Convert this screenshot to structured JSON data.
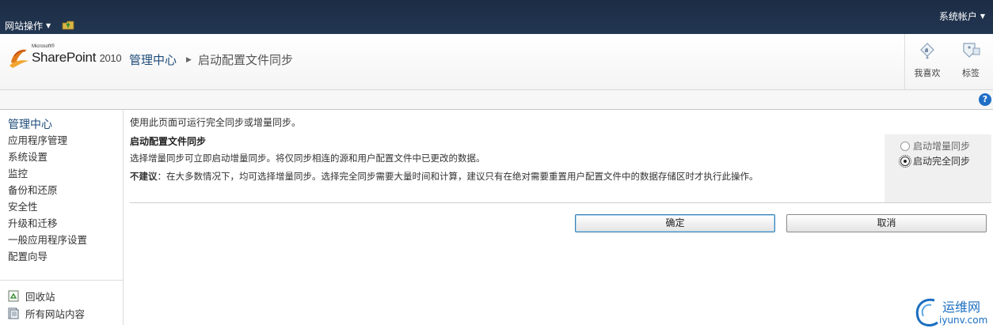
{
  "topbar": {
    "site_actions": "网站操作",
    "account": "系统帐户"
  },
  "logo": {
    "microsoft": "Microsoft®",
    "product": "SharePoint",
    "version": "2010"
  },
  "breadcrumb": {
    "root": "管理中心",
    "current": "启动配置文件同步"
  },
  "social": {
    "like": "我喜欢",
    "tags": "标签"
  },
  "help": "?",
  "nav": {
    "heading": "管理中心",
    "items": [
      "应用程序管理",
      "系统设置",
      "监控",
      "备份和还原",
      "安全性",
      "升级和迁移",
      "一般应用程序设置",
      "配置向导"
    ],
    "recycle_bin": "回收站",
    "all_content": "所有网站内容"
  },
  "main": {
    "description": "使用此页面可运行完全同步或增量同步。",
    "section_title": "启动配置文件同步",
    "section_desc": "选择增量同步可立即启动增量同步。将仅同步相连的源和用户配置文件中已更改的数据。",
    "note_label": "不建议",
    "note_text": "：在大多数情况下，均可选择增量同步。选择完全同步需要大量时间和计算，建议只有在绝对需要重置用户配置文件中的数据存储区时才执行此操作。",
    "options": {
      "incremental": "启动增量同步",
      "full": "启动完全同步",
      "selected": "full"
    },
    "ok_label": "确定",
    "cancel_label": "取消"
  },
  "watermark": {
    "cn": "运维网",
    "url": "iyunv.com"
  },
  "colors": {
    "topbar": "#1c2c44",
    "link": "#1f4c79",
    "help": "#1f6fc7"
  }
}
